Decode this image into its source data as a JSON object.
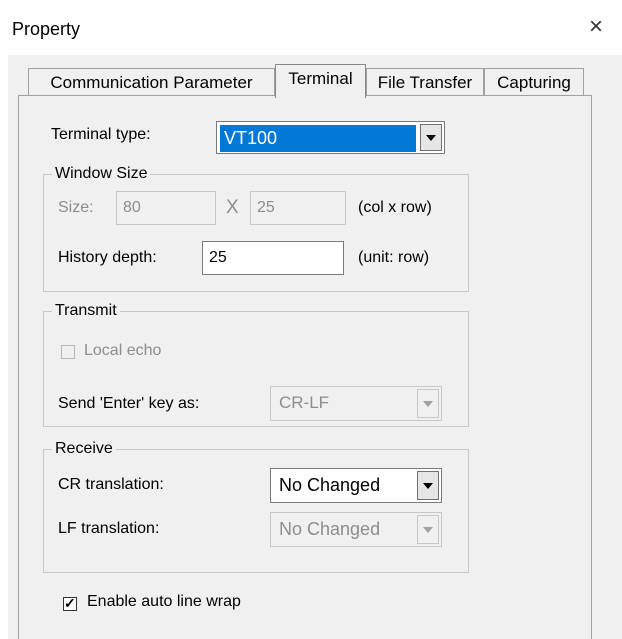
{
  "window": {
    "title": "Property"
  },
  "tabs": [
    {
      "label": "Communication Parameter"
    },
    {
      "label": "Terminal"
    },
    {
      "label": "File Transfer"
    },
    {
      "label": "Capturing"
    }
  ],
  "terminal": {
    "terminal_type_label": "Terminal type:",
    "terminal_type_value": "VT100",
    "window_size": {
      "legend": "Window Size",
      "size_label": "Size:",
      "cols_value": "80",
      "x_sep": "X",
      "rows_value": "25",
      "size_unit": "(col x row)",
      "history_label": "History depth:",
      "history_value": "25",
      "history_unit": "(unit: row)"
    },
    "transmit": {
      "legend": "Transmit",
      "local_echo_label": "Local echo",
      "local_echo_checked": false,
      "send_enter_label": "Send 'Enter' key  as:",
      "send_enter_value": "CR-LF"
    },
    "receive": {
      "legend": "Receive",
      "cr_label": "CR translation:",
      "cr_value": "No Changed",
      "lf_label": "LF translation:",
      "lf_value": "No Changed"
    },
    "auto_wrap": {
      "label": "Enable auto line wrap",
      "checked": true,
      "check_glyph": "✓"
    }
  },
  "icons": {
    "close": "×"
  },
  "colors": {
    "selection": "#0078d7",
    "dialog_bg": "#f0f0f0",
    "disabled_text": "#8d8d8d"
  }
}
